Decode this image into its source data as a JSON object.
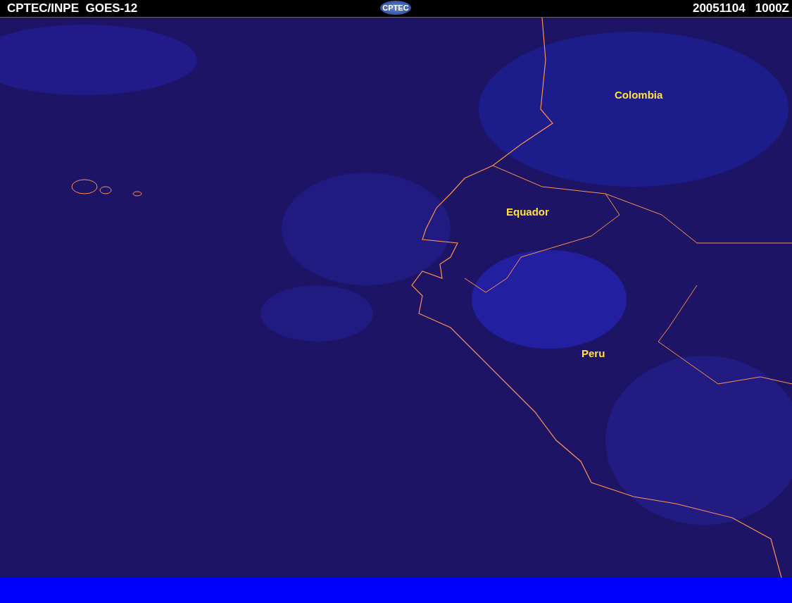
{
  "header": {
    "title": "CPTEC/INPE  GOES-12",
    "logo": "CPTEC",
    "timestamp": "20051104   1000Z"
  },
  "map": {
    "labels": [
      "Colombia",
      "Equador",
      "Peru"
    ]
  }
}
